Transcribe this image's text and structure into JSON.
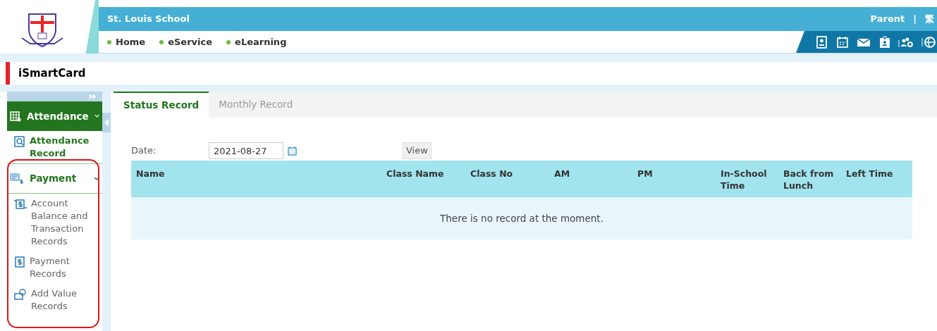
{
  "header": {
    "school_name": "St. Louis School",
    "nav": [
      "Home",
      "eService",
      "eLearning"
    ],
    "user_links": [
      "Parent",
      "|",
      "繁"
    ]
  },
  "page_title": "iSmartCard",
  "sidebar": {
    "sections": [
      {
        "label": "Attendance",
        "expanded": true,
        "selected": true,
        "items": [
          {
            "label": "Attendance Record",
            "selected": true
          }
        ]
      },
      {
        "label": "Payment",
        "expanded": true,
        "selected": false,
        "items": [
          {
            "label": "Account Balance and Transaction Records",
            "selected": false
          },
          {
            "label": "Payment Records",
            "selected": false
          },
          {
            "label": "Add Value Records",
            "selected": false
          }
        ]
      }
    ]
  },
  "tabs": [
    {
      "label": "Status Record",
      "selected": true
    },
    {
      "label": "Monthly Record",
      "selected": false
    }
  ],
  "filter": {
    "label": "Date:",
    "value": "2021-08-27",
    "button": "View"
  },
  "table": {
    "columns": [
      "Name",
      "Class Name",
      "Class No",
      "AM",
      "PM",
      "In-School Time",
      "Back from Lunch",
      "Left Time"
    ],
    "empty_message": "There is no record at the moment."
  }
}
